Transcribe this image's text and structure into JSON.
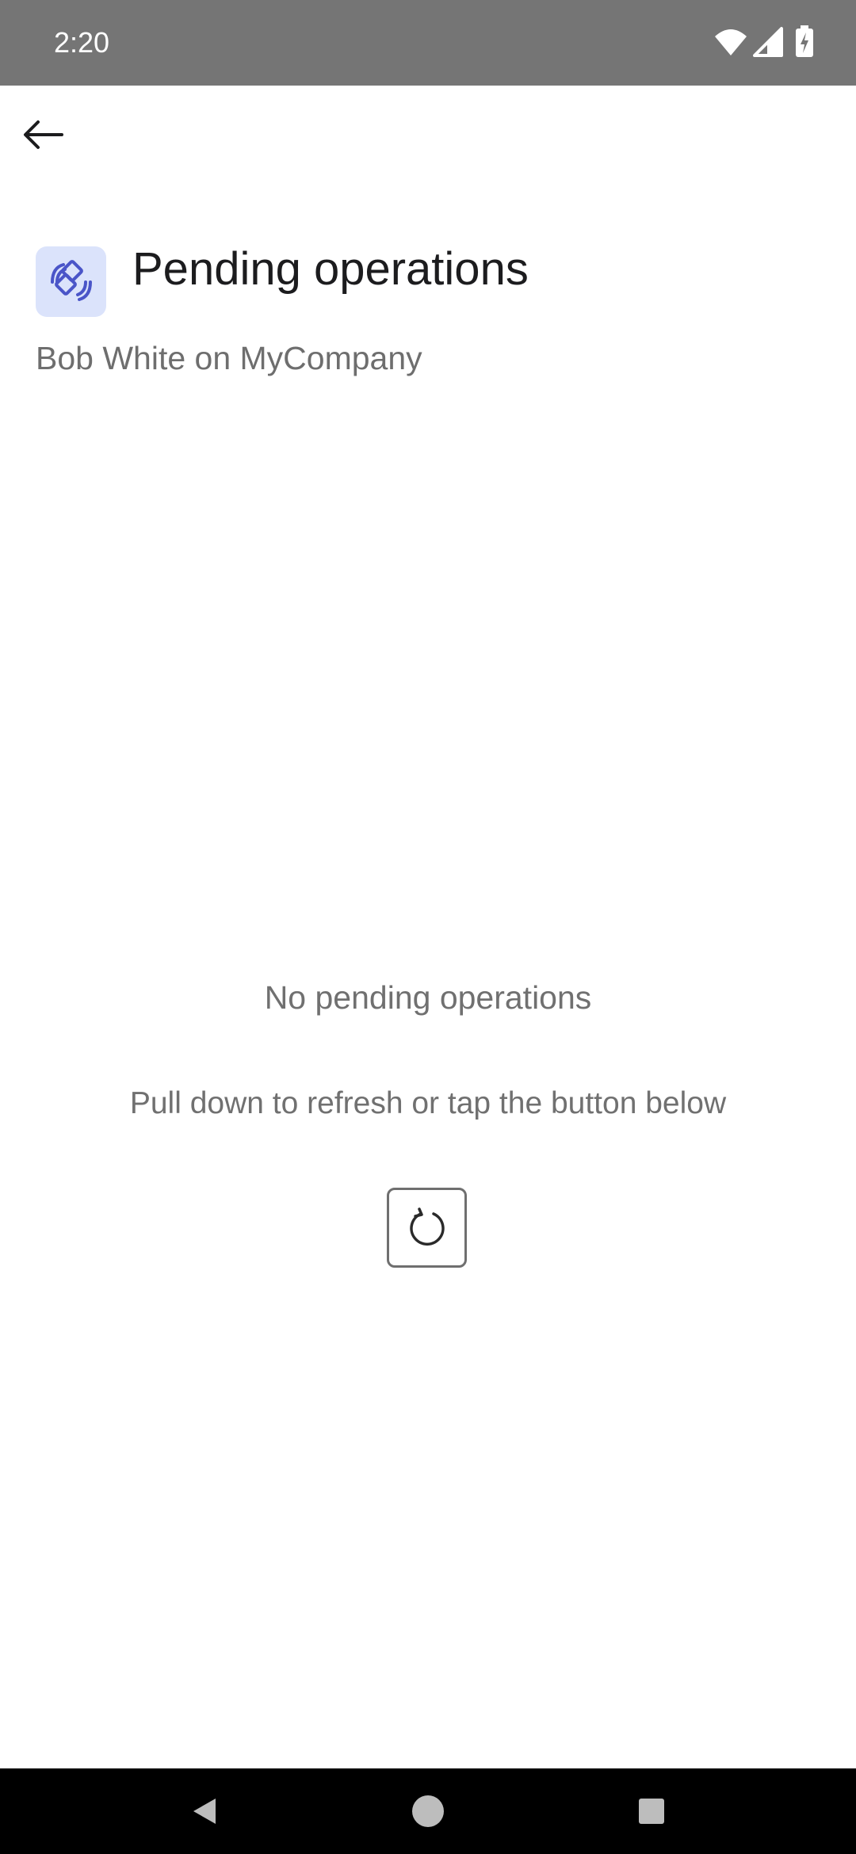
{
  "status_bar": {
    "time": "2:20",
    "icons": [
      "wifi-icon",
      "cellular-signal-icon",
      "battery-charging-icon"
    ]
  },
  "app_bar": {
    "back_icon": "arrow-left-icon"
  },
  "header": {
    "icon": "pending-operations-icon",
    "title": "Pending operations",
    "subtitle": "Bob White on MyCompany"
  },
  "empty_state": {
    "title": "No pending operations",
    "hint": "Pull down to refresh or tap the button below",
    "refresh_icon": "refresh-icon"
  },
  "nav_bar": {
    "buttons": [
      "back-triangle-icon",
      "home-circle-icon",
      "recents-square-icon"
    ]
  },
  "colors": {
    "status_bar": "#757575",
    "icon_tile_bg": "#dbe3fb",
    "icon_accent": "#4a55c8",
    "title_text": "#1c1c1e",
    "secondary_text": "#6e6e6e",
    "nav_bar": "#000000"
  }
}
